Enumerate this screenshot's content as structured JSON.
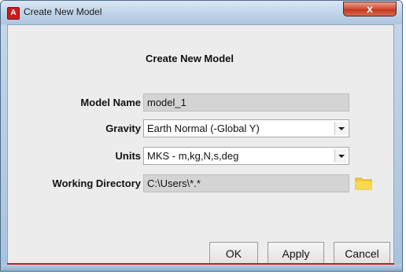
{
  "window": {
    "title": "Create New Model",
    "app_icon_letter": "A",
    "close_glyph": "x"
  },
  "dialog": {
    "header": "Create New Model",
    "fields": {
      "model_name": {
        "label": "Model Name",
        "value": "model_1"
      },
      "gravity": {
        "label": "Gravity",
        "value": "Earth Normal (-Global Y)"
      },
      "units": {
        "label": "Units",
        "value": "MKS - m,kg,N,s,deg"
      },
      "working_directory": {
        "label": "Working Directory",
        "value": "C:\\Users\\*.*"
      }
    }
  },
  "buttons": {
    "ok": "OK",
    "apply": "Apply",
    "cancel": "Cancel"
  },
  "icons": {
    "folder": "folder-icon",
    "dropdown": "chevron-down-icon",
    "close": "close-icon",
    "app": "app-icon"
  },
  "colors": {
    "accent_red": "#c81e1e",
    "folder_yellow": "#f6c933"
  }
}
